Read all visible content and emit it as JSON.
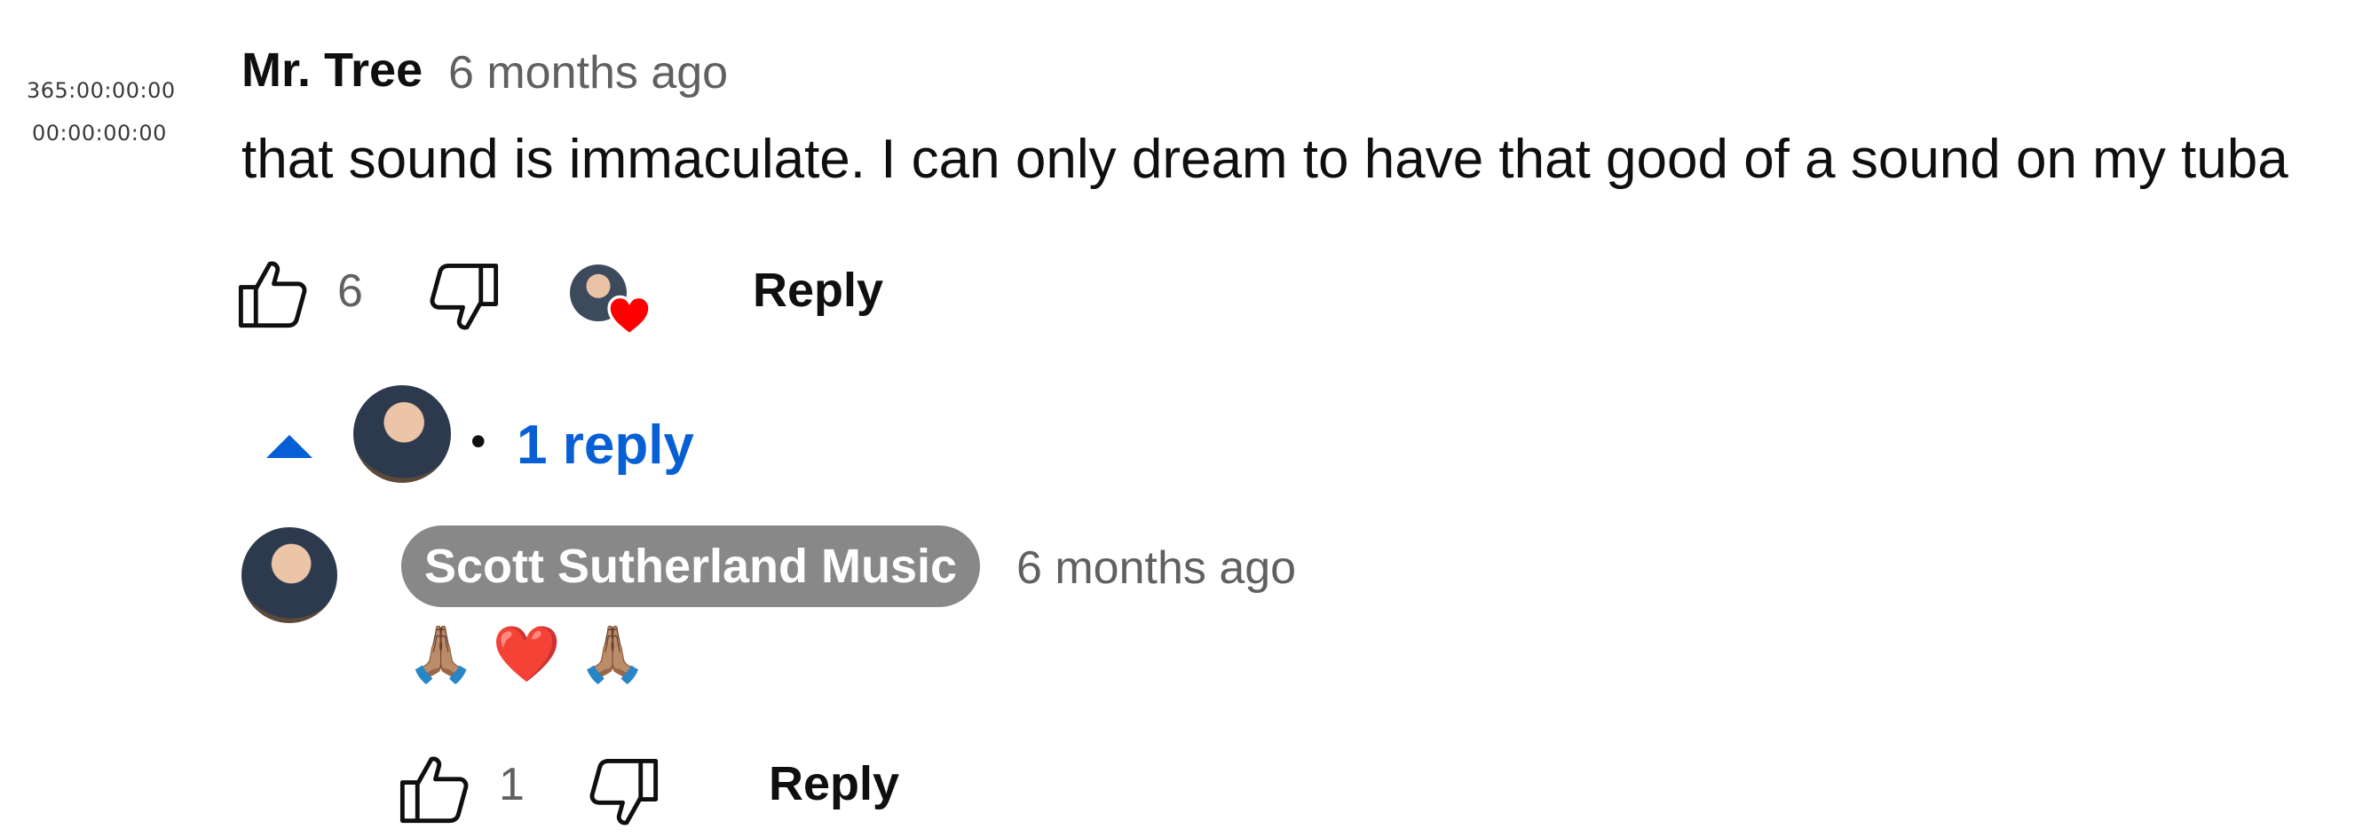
{
  "timestamps": {
    "line1": "365:00:00:00",
    "line2": "00:00:00:00"
  },
  "comment": {
    "author": "Mr. Tree",
    "time": "6 months ago",
    "text": "that sound is immaculate. I can only dream to have that good of a sound on my tuba",
    "like_count": "6",
    "reply_label": "Reply",
    "creator_heart": true
  },
  "replies_toggle": {
    "label": "1 reply",
    "separator": "•",
    "expanded": true
  },
  "reply": {
    "author": "Scott Sutherland Music",
    "time": "6 months ago",
    "text": "🙏🏽 ❤️ 🙏🏽",
    "like_count": "1",
    "reply_label": "Reply"
  },
  "colors": {
    "link_blue": "#065fd4",
    "heart_red": "#ff0000",
    "channel_badge_bg": "#888888",
    "muted_text": "#606060"
  },
  "icons": [
    "thumbs-up-icon",
    "thumbs-down-icon",
    "chevron-up-icon",
    "heart-icon",
    "avatar"
  ]
}
